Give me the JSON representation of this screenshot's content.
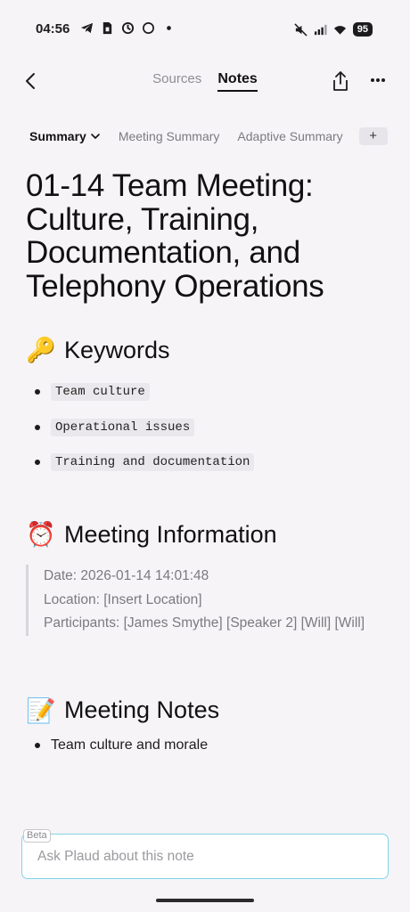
{
  "status_bar": {
    "time": "04:56",
    "left_icons": [
      "telegram-icon",
      "sim-card-icon",
      "sync-icon",
      "circle-icon",
      "dot-icon"
    ],
    "right_icons": [
      "mute-icon",
      "signal-icon",
      "wifi-icon"
    ],
    "battery": "95"
  },
  "header": {
    "tab_sources": "Sources",
    "tab_notes": "Notes",
    "active_tab": "Notes"
  },
  "template_tabs": {
    "summary": "Summary",
    "items": [
      "Meeting Summary",
      "Adaptive Summary"
    ],
    "add_label": "+"
  },
  "document": {
    "title": "01-14 Team Meeting: Culture, Training, Documentation, and Telephony Operations",
    "keywords_heading": "Keywords",
    "keywords_emoji": "🔑",
    "keywords": [
      "Team culture",
      "Operational issues",
      "Training and documentation"
    ],
    "info_heading": "Meeting Information",
    "info_emoji": "⏰",
    "info": {
      "date": "Date: 2026-01-14 14:01:48",
      "location": "Location: [Insert Location]",
      "participants": "Participants: [James Smythe] [Speaker 2] [Will] [Will]"
    },
    "notes_heading": "Meeting Notes",
    "notes_emoji": "📝",
    "notes": [
      "Team culture and morale"
    ]
  },
  "ask": {
    "beta": "Beta",
    "placeholder": "Ask Plaud about this note"
  },
  "colors": {
    "background": "#f6f4f7",
    "accent_border": "#7fd6e8",
    "chip_bg": "#eae8ec"
  }
}
